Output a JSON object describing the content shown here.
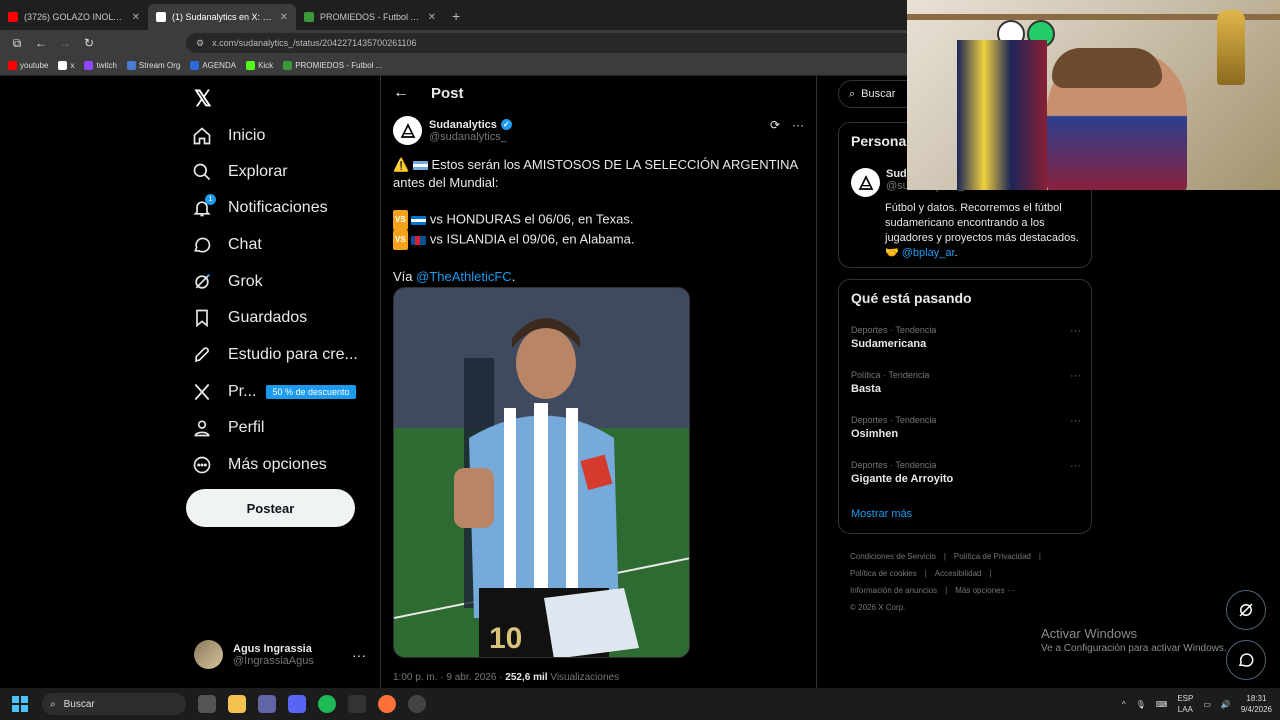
{
  "browser": {
    "tabs": [
      {
        "title": "(3726) GOLAZO INOLVIDABLE |",
        "color": "#ff0000",
        "active": false
      },
      {
        "title": "(1) Sudanalytics en X: \"⚠️🇦🇷 Es",
        "color": "#ffffff",
        "active": true
      },
      {
        "title": "PROMIEDOS - Futbol Argentino",
        "color": "#3a9a3a",
        "active": false
      }
    ],
    "new_tab": "+",
    "url": "x.com/sudanalytics_/status/2042271435700261106",
    "bookmarks": [
      {
        "label": "youtube",
        "color": "#ff0000"
      },
      {
        "label": "x",
        "color": "#ffffff"
      },
      {
        "label": "twitch",
        "color": "#9146ff"
      },
      {
        "label": "Stream Org",
        "color": "#4a7bd4"
      },
      {
        "label": "AGENDA",
        "color": "#2b6ad8"
      },
      {
        "label": "Kick",
        "color": "#53fc18"
      },
      {
        "label": "PROMIEDOS - Futbol ...",
        "color": "#3a9a3a"
      }
    ]
  },
  "sidebar": {
    "logo": "𝕏",
    "items": [
      {
        "label": "Inicio",
        "icon": "home-icon"
      },
      {
        "label": "Explorar",
        "icon": "search-icon"
      },
      {
        "label": "Notificaciones",
        "icon": "bell-icon",
        "badge": "1"
      },
      {
        "label": "Chat",
        "icon": "chat-icon"
      },
      {
        "label": "Grok",
        "icon": "grok-icon"
      },
      {
        "label": "Guardados",
        "icon": "bookmark-icon"
      },
      {
        "label": "Estudio para cre...",
        "icon": "rocket-icon"
      },
      {
        "label": "Pr...",
        "icon": "x-premium-icon",
        "promo": "50 % de descuento"
      },
      {
        "label": "Perfil",
        "icon": "person-icon"
      },
      {
        "label": "Más opciones",
        "icon": "more-circle-icon"
      }
    ],
    "post_button": "Postear",
    "profile": {
      "name": "Agus Ingrassia",
      "handle": "@IngrassiaAgus",
      "more": "···"
    }
  },
  "post": {
    "header_title": "Post",
    "author_name": "Sudanalytics",
    "author_handle": "@sudanalytics_",
    "text": {
      "line1_prefix": "⚠️",
      "line1": "Estos serán los AMISTOSOS DE LA SELECCIÓN ARGENTINA antes del Mundial:",
      "vs_badge": "VS",
      "match1": "vs HONDURAS el 06/06, en Texas.",
      "match2": "vs ISLANDIA el 09/06, en Alabama.",
      "via_prefix": "Vía ",
      "via_link": "@TheAthleticFC",
      "via_suffix": "."
    },
    "meta_time": "1:00 p. m. · 9 abr. 2026 · ",
    "meta_views": "252,6 mil",
    "meta_views_label": " Visualizaciones"
  },
  "right": {
    "search_placeholder": "Buscar",
    "persona": {
      "title": "Persona",
      "name": "Sud",
      "handle": "@sudanalytics_",
      "bio": "Fútbol y datos. Recorremos el fútbol sudamericano encontrando a los jugadores y proyectos más destacados. 🤝",
      "bio_link": "@bplay_ar",
      "bio_suffix": "."
    },
    "trends_title": "Qué está pasando",
    "trends": [
      {
        "category": "Deportes · Tendencia",
        "name": "Sudamericana"
      },
      {
        "category": "Política · Tendencia",
        "name": "Basta"
      },
      {
        "category": "Deportes · Tendencia",
        "name": "Osimhen"
      },
      {
        "category": "Deportes · Tendencia",
        "name": "Gigante de Arroyito"
      }
    ],
    "show_more": "Mostrar más",
    "footer": {
      "l1a": "Condiciones de Servicio",
      "l1b": "Política de Privacidad",
      "l2a": "Política de cookies",
      "l2b": "Accesibilidad",
      "l3a": "Información de anuncios",
      "l3b": "Más opciones ···",
      "copyright": "© 2026 X Corp."
    }
  },
  "windows": {
    "activate_title": "Activar Windows",
    "activate_sub": "Ve a Configuración para activar Windows.",
    "search": "Buscar",
    "lang1": "ESP",
    "lang2": "LAA",
    "time": "18:31",
    "date": "9/4/2026"
  }
}
